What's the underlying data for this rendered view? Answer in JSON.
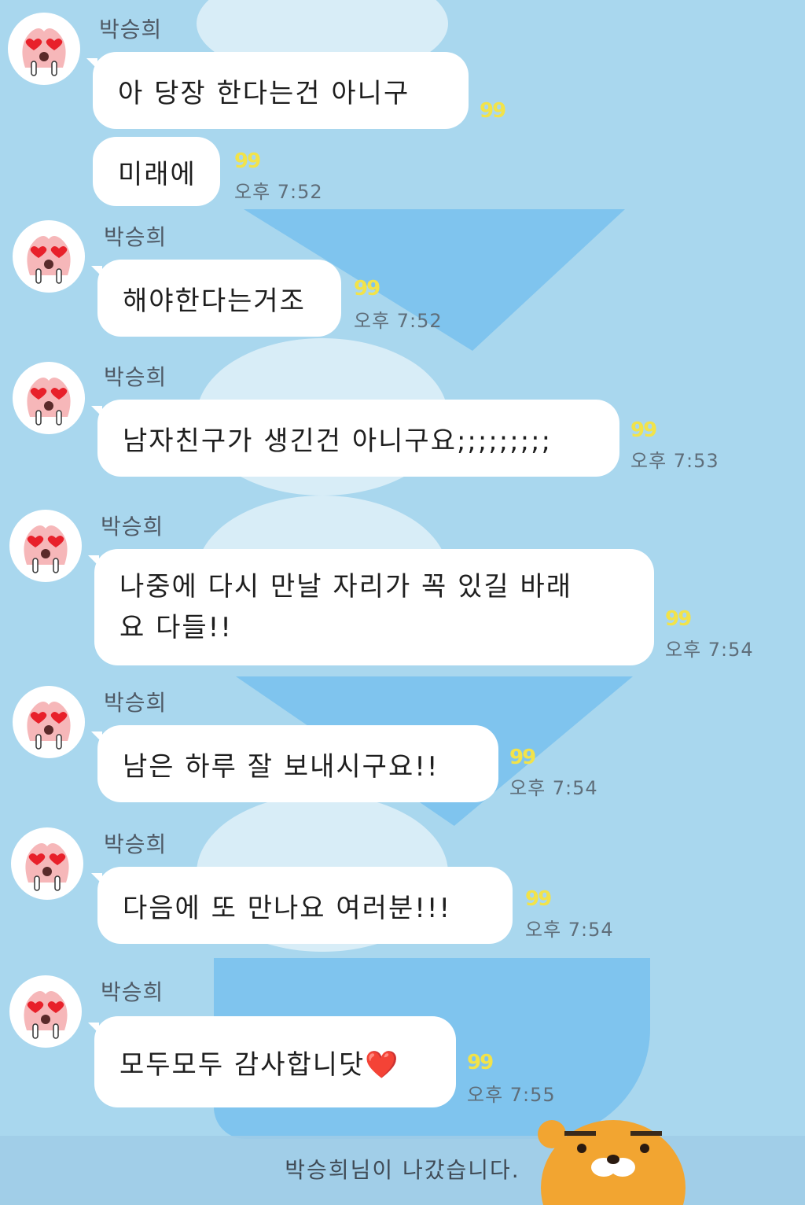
{
  "chat": {
    "messages": [
      {
        "sender": "박승희",
        "lines": [
          "아 당장 한다는건 아니구"
        ],
        "read": "99",
        "time": ""
      },
      {
        "sender": "",
        "lines": [
          "미래에"
        ],
        "read": "99",
        "time": "오후 7:52"
      },
      {
        "sender": "박승희",
        "lines": [
          "해야한다는거조"
        ],
        "read": "99",
        "time": "오후 7:52"
      },
      {
        "sender": "박승희",
        "lines": [
          "남자친구가 생긴건 아니구요;;;;;;;;;"
        ],
        "read": "99",
        "time": "오후 7:53"
      },
      {
        "sender": "박승희",
        "lines": [
          "나중에 다시 만날 자리가 꼭 있길 바래",
          "요 다들!!"
        ],
        "read": "99",
        "time": "오후 7:54"
      },
      {
        "sender": "박승희",
        "lines": [
          "남은 하루 잘 보내시구요!!"
        ],
        "read": "99",
        "time": "오후 7:54"
      },
      {
        "sender": "박승희",
        "lines": [
          "다음에 또 만나요 여러분!!!"
        ],
        "read": "99",
        "time": "오후 7:54"
      },
      {
        "sender": "박승희",
        "lines": [
          "모두모두 감사합니닷❤️"
        ],
        "read": "99",
        "time": "오후 7:55"
      }
    ],
    "system_notice": "박승희님이 나갔습니다."
  },
  "avatar_icon": "apeach-heart-eyes-icon",
  "character_icon": "ryan-bear-icon",
  "colors": {
    "background": "#a9d7ee",
    "bubble": "#ffffff",
    "read_count": "#f2e34a",
    "time": "#5f6e7a"
  }
}
